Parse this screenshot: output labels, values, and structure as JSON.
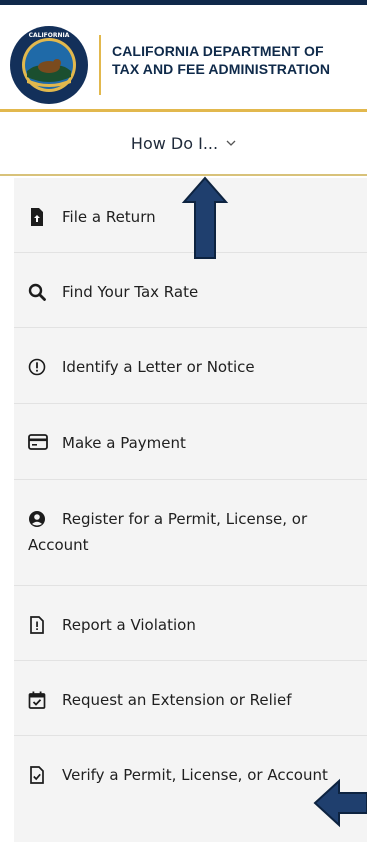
{
  "header": {
    "agency_line1": "CALIFORNIA DEPARTMENT OF",
    "agency_line2": "TAX AND FEE ADMINISTRATION",
    "seal_text": "CALIFORNIA DEPARTMENT OF TAX AND FEE ADMINISTRATION",
    "colors": {
      "navy": "#10294a",
      "gold": "#e2b84d"
    }
  },
  "how_do_i": {
    "label": "How Do I...",
    "icon": "chevron-down-icon"
  },
  "menu": {
    "items": [
      {
        "label": "File a Return",
        "icon": "file-upload-icon"
      },
      {
        "label": "Find Your Tax Rate",
        "icon": "search-icon"
      },
      {
        "label": "Identify a Letter or Notice",
        "icon": "info-circle-icon"
      },
      {
        "label": "Make a Payment",
        "icon": "credit-card-icon"
      },
      {
        "label": "Register for a Permit, License, or Account",
        "icon": "user-circle-icon"
      },
      {
        "label": "Report a Violation",
        "icon": "report-icon"
      },
      {
        "label": "Request an Extension or Relief",
        "icon": "calendar-check-icon"
      },
      {
        "label": "Verify a Permit, License, or Account",
        "icon": "file-check-icon"
      }
    ]
  },
  "annotations": {
    "arrows": [
      {
        "direction": "up",
        "points_to": "how-do-i-menu",
        "color": "#1f3f6e"
      },
      {
        "direction": "left",
        "points_to": "menu-item-verify",
        "color": "#1f3f6e"
      }
    ]
  }
}
